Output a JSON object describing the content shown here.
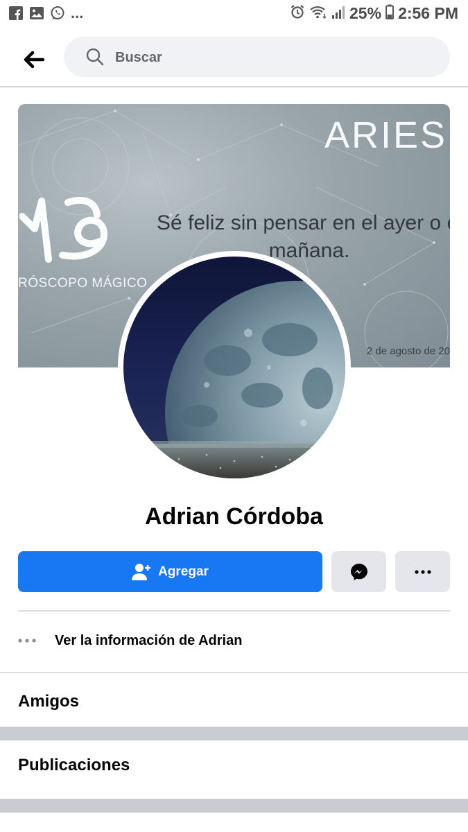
{
  "status_bar": {
    "battery": "25%",
    "time": "2:56 PM",
    "left_icons": [
      "facebook-icon",
      "gallery-icon",
      "whatsapp-icon"
    ],
    "more": "..."
  },
  "search": {
    "placeholder": "Buscar",
    "value": ""
  },
  "cover": {
    "title": "ARIES",
    "quote_line1": "Sé feliz sin pensar en el ayer o el",
    "quote_line2": "mañana.",
    "brand": "RÓSCOPO MÁGICO",
    "date": "2 de agosto de 20"
  },
  "profile": {
    "name": "Adrian Córdoba"
  },
  "actions": {
    "add_label": "Agregar"
  },
  "info": {
    "label": "Ver la información de Adrian"
  },
  "sections": {
    "friends": "Amigos",
    "posts": "Publicaciones"
  },
  "colors": {
    "primary": "#1877f2",
    "grey_button": "#e4e6eb",
    "search_bg": "#f0f2f5"
  }
}
